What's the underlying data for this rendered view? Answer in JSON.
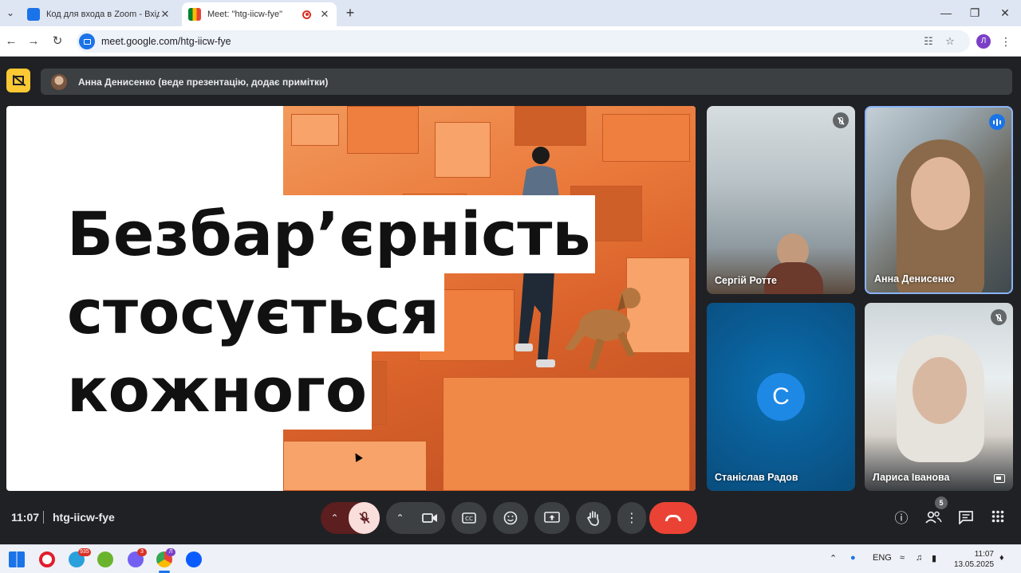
{
  "browser": {
    "tabs": [
      {
        "title": "Код для входа в Zoom - Вхідні",
        "active": false
      },
      {
        "title": "Meet: \"htg-iicw-fye\"",
        "active": true
      }
    ],
    "url": "meet.google.com/htg-iicw-fye",
    "profile_initial": "Л"
  },
  "meet": {
    "presenter_banner": "Анна Денисенко (веде презентацію, додає примітки)",
    "slide": {
      "lines": [
        "Безбар’єрність",
        "стосується",
        "кожного"
      ]
    },
    "participants": [
      {
        "name": "Сергій Ротте",
        "state": "muted"
      },
      {
        "name": "Анна Денисенко",
        "state": "speaking"
      },
      {
        "name": "Станіслав Радов",
        "avatar_letter": "С",
        "state": "none"
      },
      {
        "name": "Лариса Іванова",
        "state": "muted"
      }
    ],
    "time": "11:07",
    "meeting_code": "htg-iicw-fye",
    "people_count": "5",
    "colors": {
      "end_call": "#ea4335",
      "mic_off_bg": "#f9dedc",
      "speaking": "#1a73e8"
    }
  },
  "taskbar": {
    "telegram_badge": "935",
    "viber_badge": "3",
    "chrome_profile_badge": "Л",
    "language": "ENG",
    "time": "11:07",
    "date": "13.05.2025"
  }
}
